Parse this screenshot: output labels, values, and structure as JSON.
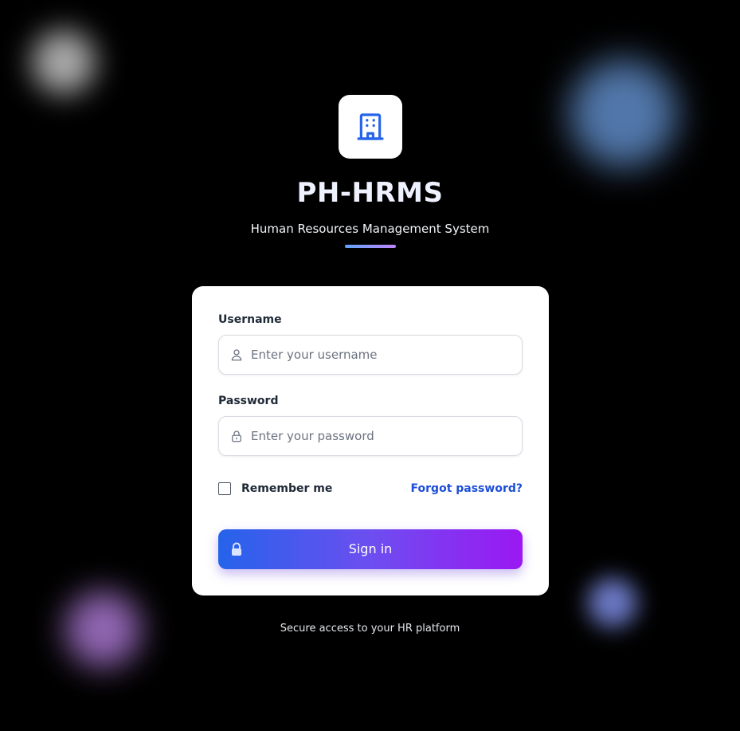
{
  "brand": {
    "title": "PH-HRMS",
    "subtitle": "Human Resources Management System",
    "logo_icon": "building-icon",
    "accent_color": "#2563eb"
  },
  "form": {
    "username": {
      "label": "Username",
      "placeholder": "Enter your username",
      "value": "",
      "icon": "user-icon"
    },
    "password": {
      "label": "Password",
      "placeholder": "Enter your password",
      "value": "",
      "icon": "lock-icon"
    },
    "remember_label": "Remember me",
    "remember_checked": false,
    "forgot_label": "Forgot password?",
    "forgot_color": "#1d4ed8",
    "submit_label": "Sign in",
    "submit_icon": "lock-icon",
    "submit_gradient": [
      "#2563eb",
      "#9b18f2"
    ]
  },
  "footer": {
    "text": "Secure access to your HR platform"
  }
}
